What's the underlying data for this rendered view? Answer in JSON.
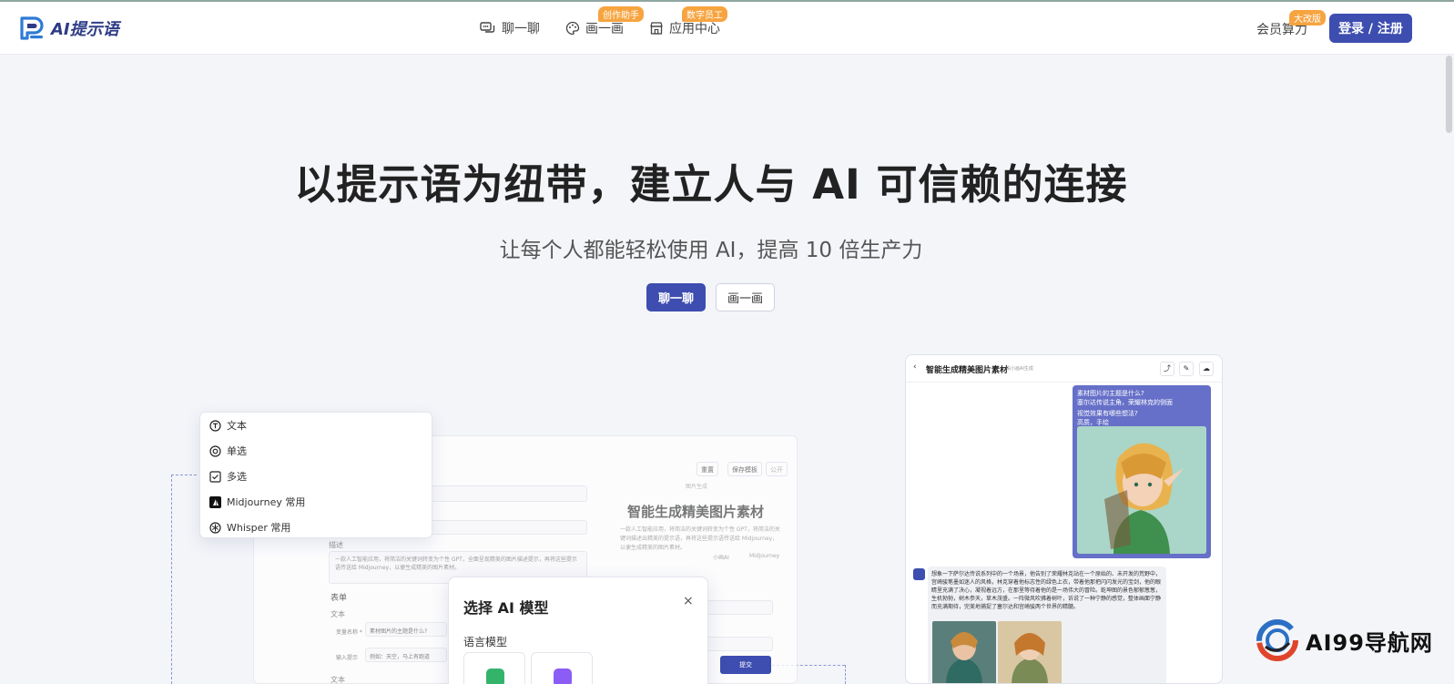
{
  "header": {
    "logo_text": "AI提示语",
    "nav": [
      {
        "label": "聊一聊",
        "badge": ""
      },
      {
        "label": "画一画",
        "badge": "创作助手"
      },
      {
        "label": "应用中心",
        "badge": "数字员工"
      }
    ],
    "member_label": "会员算力",
    "member_badge": "大改版",
    "login_label": "登录 / 注册"
  },
  "hero": {
    "title": "以提示语为纽带，建立人与 AI 可信赖的连接",
    "subtitle": "让每个人都能轻松使用 AI，提高 10 倍生产力",
    "cta_primary": "聊一聊",
    "cta_secondary": "画一画"
  },
  "menu_card": {
    "items": [
      "文本",
      "单选",
      "多选",
      "Midjourney 常用",
      "Whisper 常用"
    ]
  },
  "form_panel": {
    "desc_label": "描述",
    "desc_text": "一款人工智能应用，将简洁的关键词转变为个性 GPT，全面呈现精美的图片描述提示，再将这些提示语传送给 Midjourney，以便生成精美的图片素材。",
    "form_label": "表单",
    "text_label": "文本",
    "field1_name": "变量名称 *",
    "field1_value": "素材图片的主题是什么?",
    "field2_name": "输入提示",
    "field2_value": "例如：天空，马上有跑道",
    "text_label2": "文本",
    "btn_clear": "重置",
    "btn_save": "保存模板",
    "btn_add": "公开",
    "preview_title": "智能生成精美图片素材",
    "preview_tag": "图片生成",
    "preview_desc": "一款人工智能应用，将简洁的关键词转变为个性 GPT，将简洁的关键词描述出精美的提示语，再将这些提示语传送给 Midjourney，以便生成精美的图片素材。",
    "preview_meta1": "小画AI",
    "preview_meta2": "Midjourney",
    "submit_label": "提交"
  },
  "model_card": {
    "title": "选择 AI 模型",
    "close": "×",
    "section": "语言模型",
    "colors": [
      "#34b36b",
      "#8b5cf6"
    ]
  },
  "chat_card": {
    "title": "智能生成精美图片素材",
    "tag": "由小画AI生成",
    "user_lines": [
      "素材图片的主题是什么?",
      "塞尔达传说主角，荣耀林克的侧面",
      "视觉效果有哪些想法?",
      "高质，手绘"
    ],
    "ai_text": "想象一下萨尔达传说系列中的一个场景，他告别了荣耀林克站在一个原始的、未开发的荒野中，宫崎骏笔墨如迷人的风格，林克穿着他标志性的绿色上衣，带着他那把闪闪发光的宝剑，他的眼睛里充满了决心，凝视着远方，在那里等待着他的是一场伟大的冒险。乾坤图的景色郁郁葱葱，生机勃勃，树木参天，草木茂盛。一阵微风吹拂着树叶，诉说了一种宁静的感觉，整体画面宁静而充满期待，完美地捕捉了塞尔达和宫崎骏两个世界的精髓。"
  },
  "watermark": {
    "text": "AI99导航网"
  }
}
